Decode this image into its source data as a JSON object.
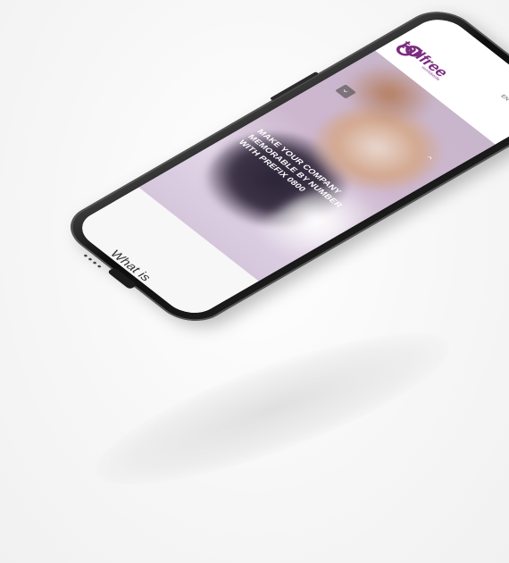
{
  "brand": {
    "logo_text": "tollfree",
    "logo_sub": "worldwide",
    "accent": "#7b2c7f",
    "logo_icon": "tollfree-logo-icon"
  },
  "header": {
    "menu_icon": "hamburger-icon",
    "language": "EN"
  },
  "hero": {
    "headline": "MAKE YOUR COMPANY MEMORABLE BY NUMBER WITH PREFIX 0800",
    "prev_label": "‹",
    "next_label": "›"
  },
  "section": {
    "heading": "What is\nTOLLFREE ?"
  }
}
